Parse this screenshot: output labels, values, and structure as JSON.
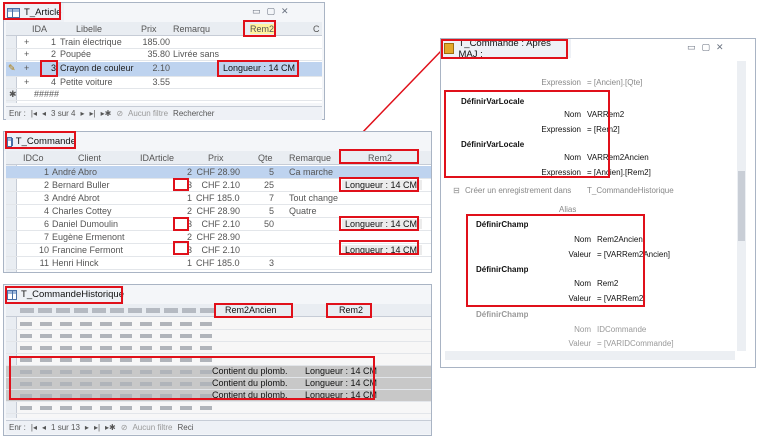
{
  "colors": {
    "highlight_red": "#e0101a",
    "tag_yellow": "#fff3a0",
    "selected_row": "#bed3ef"
  },
  "t_article": {
    "title": "T_Article",
    "columns": [
      "IDA",
      "Libelle",
      "Prix",
      "Remarqu",
      "Rem2",
      "C"
    ],
    "rows": [
      {
        "expander": "+",
        "id": "1",
        "libelle": "Train électrique",
        "prix": "185.00",
        "remarque": "",
        "rem2": ""
      },
      {
        "expander": "+",
        "id": "2",
        "libelle": "Poupée",
        "prix": "35.80",
        "remarque": "Livrée sans",
        "rem2": ""
      },
      {
        "expander": "+",
        "id": "3",
        "libelle": "Crayon de couleur",
        "prix": "2.10",
        "remarque": "",
        "rem2": "Longueur : 14 CM"
      },
      {
        "expander": "+",
        "id": "4",
        "libelle": "Petite voiture",
        "prix": "3.55",
        "remarque": "",
        "rem2": ""
      }
    ],
    "new_row": "#####",
    "status": {
      "prefix": "Enr :",
      "position": "3 sur 4",
      "filter": "Aucun filtre",
      "search": "Rechercher"
    }
  },
  "t_commande": {
    "title": "T_Commande",
    "columns": [
      "IDCo",
      "Client",
      "IDArticle",
      "Prix",
      "Qte",
      "Remarque",
      "Rem2"
    ],
    "rows": [
      {
        "id": "1",
        "client": "André Abro",
        "idarticle": "2",
        "prix": "CHF 28.90",
        "qte": "5",
        "remarque": "Ca marche",
        "rem2": ""
      },
      {
        "id": "2",
        "client": "Bernard Buller",
        "idarticle": "3",
        "prix": "CHF 2.10",
        "qte": "25",
        "remarque": "",
        "rem2": "Longueur : 14 CM"
      },
      {
        "id": "3",
        "client": "André Abrot",
        "idarticle": "1",
        "prix": "CHF 185.00",
        "qte": "7",
        "remarque": "Tout change",
        "rem2": ""
      },
      {
        "id": "4",
        "client": "Charles Cottey",
        "idarticle": "2",
        "prix": "CHF 28.90",
        "qte": "5",
        "remarque": "Quatre",
        "rem2": ""
      },
      {
        "id": "6",
        "client": "Daniel Dumoulin",
        "idarticle": "3",
        "prix": "CHF 2.10",
        "qte": "50",
        "remarque": "",
        "rem2": "Longueur : 14 CM"
      },
      {
        "id": "7",
        "client": "Eugène Ermenont",
        "idarticle": "2",
        "prix": "CHF 28.90",
        "qte": "",
        "remarque": "",
        "rem2": ""
      },
      {
        "id": "10",
        "client": "Francine Fermont",
        "idarticle": "3",
        "prix": "CHF 2.10",
        "qte": "",
        "remarque": "",
        "rem2": "Longueur : 14 CM"
      },
      {
        "id": "11",
        "client": "Henri Hinck",
        "idarticle": "1",
        "prix": "CHF 185.00",
        "qte": "3",
        "remarque": "",
        "rem2": ""
      }
    ]
  },
  "t_historique": {
    "title": "T_CommandeHistorique",
    "col_rem2ancien": "Rem2Ancien",
    "col_rem2": "Rem2",
    "highlight_rows": [
      {
        "rem2ancien": "Contient du plomb.",
        "rem2": "Longueur : 14 CM"
      },
      {
        "rem2ancien": "Contient du plomb.",
        "rem2": "Longueur : 14 CM"
      },
      {
        "rem2ancien": "Contient du plomb.",
        "rem2": "Longueur : 14 CM"
      }
    ],
    "status": {
      "prefix": "Enr :",
      "position": "1 sur 13",
      "filter": "Aucun filtre",
      "search": "Reci"
    }
  },
  "macro": {
    "title": "T_Commande : Après MAJ :",
    "top": {
      "label": "Expression",
      "value": "= [Ancien].[Qte]"
    },
    "block1": [
      {
        "action": "DéfinirVarLocale",
        "params": [
          {
            "label": "Nom",
            "value": "VARRem2"
          },
          {
            "label": "Expression",
            "value": "= [Rem2]"
          }
        ]
      },
      {
        "action": "DéfinirVarLocale",
        "params": [
          {
            "label": "Nom",
            "value": "VARRem2Ancien"
          },
          {
            "label": "Expression",
            "value": "= [Ancien].[Rem2]"
          }
        ]
      }
    ],
    "create": {
      "label": "Créer un enregistrement dans",
      "table": "T_CommandeHistorique"
    },
    "alias": "Alias",
    "block2": [
      {
        "action": "DéfinirChamp",
        "params": [
          {
            "label": "Nom",
            "value": "Rem2Ancien"
          },
          {
            "label": "Valeur",
            "value": "= [VARRem2Ancien]"
          }
        ]
      },
      {
        "action": "DéfinirChamp",
        "params": [
          {
            "label": "Nom",
            "value": "Rem2"
          },
          {
            "label": "Valeur",
            "value": "= [VARRem2]"
          }
        ]
      }
    ],
    "faded": {
      "action": "DéfinirChamp",
      "name_label": "Nom",
      "name_value": "IDCommande",
      "value_label": "Valeur",
      "value_value": "= [VARIDCommande]"
    }
  }
}
